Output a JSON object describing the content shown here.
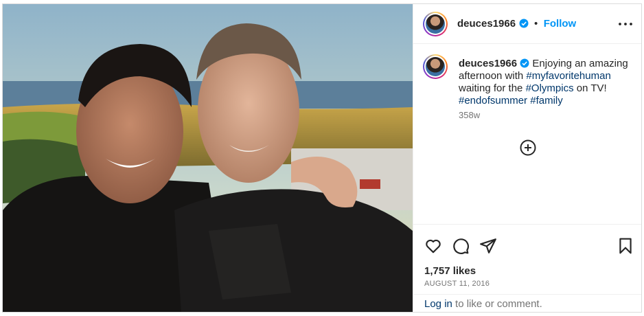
{
  "post": {
    "photo_alt": "",
    "author": {
      "username": "deuces1966",
      "verified": true
    },
    "header": {
      "separator": "•",
      "follow_label": "Follow"
    },
    "caption": {
      "username": "deuces1966",
      "parts": [
        {
          "text": "Enjoying an amazing afternoon with ",
          "tag": false
        },
        {
          "text": "#myfavoritehuman",
          "tag": true
        },
        {
          "text": " waiting for the ",
          "tag": false
        },
        {
          "text": "#Olympics",
          "tag": true
        },
        {
          "text": " on TV! ",
          "tag": false
        },
        {
          "text": "#endofsummer",
          "tag": true
        },
        {
          "text": " ",
          "tag": false
        },
        {
          "text": "#family",
          "tag": true
        }
      ],
      "time_ago": "358w"
    },
    "likes": "1,757 likes",
    "date": "AUGUST 11, 2016",
    "login": {
      "link": "Log in",
      "rest": " to like or comment."
    }
  },
  "icons": {
    "more": "more-options-icon",
    "load_comments": "plus-circle-icon",
    "like": "heart-icon",
    "comment": "comment-icon",
    "share": "paper-plane-icon",
    "save": "bookmark-icon",
    "verified": "verified-badge-icon"
  },
  "colors": {
    "follow": "#0095f6",
    "hashtag": "#00376b",
    "muted": "#737373",
    "verified": "#0095f6"
  }
}
